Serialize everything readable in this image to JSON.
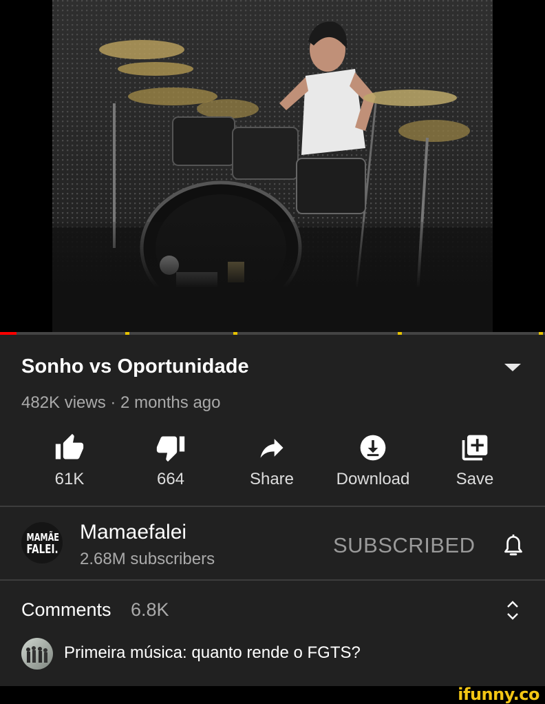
{
  "video": {
    "progress_fraction": 0.03,
    "ad_markers_fraction": [
      0.234,
      0.432,
      0.733,
      0.992
    ]
  },
  "info": {
    "title": "Sonho vs Oportunidade",
    "meta": "482K views · 2 months ago"
  },
  "actions": [
    {
      "icon": "thumbs-up-icon",
      "label": "61K"
    },
    {
      "icon": "thumbs-down-icon",
      "label": "664"
    },
    {
      "icon": "share-icon",
      "label": "Share"
    },
    {
      "icon": "download-icon",
      "label": "Download"
    },
    {
      "icon": "add-to-playlist-icon",
      "label": "Save"
    }
  ],
  "channel": {
    "avatar_text_line1": "MAMÃE",
    "avatar_text_line2": "FALEI.",
    "name": "Mamaefalei",
    "subscribers": "2.68M subscribers",
    "subscribe_state": "SUBSCRIBED"
  },
  "comments": {
    "label": "Comments",
    "count": "6.8K",
    "top_comment": "Primeira música: quanto rende o FGTS?"
  },
  "watermark": "ifunny.co",
  "colors": {
    "background": "#212121",
    "progress": "#ff0000",
    "ad_marker": "#e6c200",
    "secondary_text": "#aaaaaa"
  }
}
